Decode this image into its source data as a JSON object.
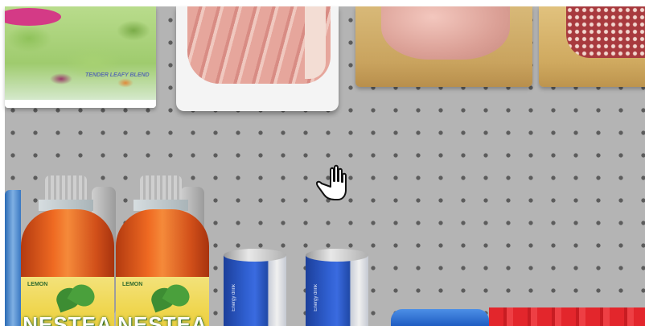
{
  "scene": "store shelf pegboard",
  "colors": {
    "pegboard": "#b4b4b4",
    "peg_hole": "#5c5c5c",
    "tea_bottle": "#ef6a22",
    "tea_label": "#efd54c",
    "can_blue": "#2f5fd0",
    "strip_red": "#e3262c"
  },
  "cursor": {
    "icon": "open-hand-icon"
  },
  "shelf_top": {
    "items": [
      {
        "kind": "salad-bag",
        "brand_text": "TENDER LEAFY BLEND"
      },
      {
        "kind": "ham-slices-tray"
      },
      {
        "kind": "sliced-meat-gold-tray"
      },
      {
        "kind": "salami-gold-tray"
      }
    ]
  },
  "shelf_bottom": {
    "bottles": [
      {
        "flavor": "LEMON",
        "brand": "NESTEA"
      },
      {
        "flavor": "LEMON",
        "brand": "NESTEA"
      }
    ],
    "cans": [
      {
        "small_text": "Energy drink"
      },
      {
        "small_text": "Energy drink"
      }
    ]
  }
}
